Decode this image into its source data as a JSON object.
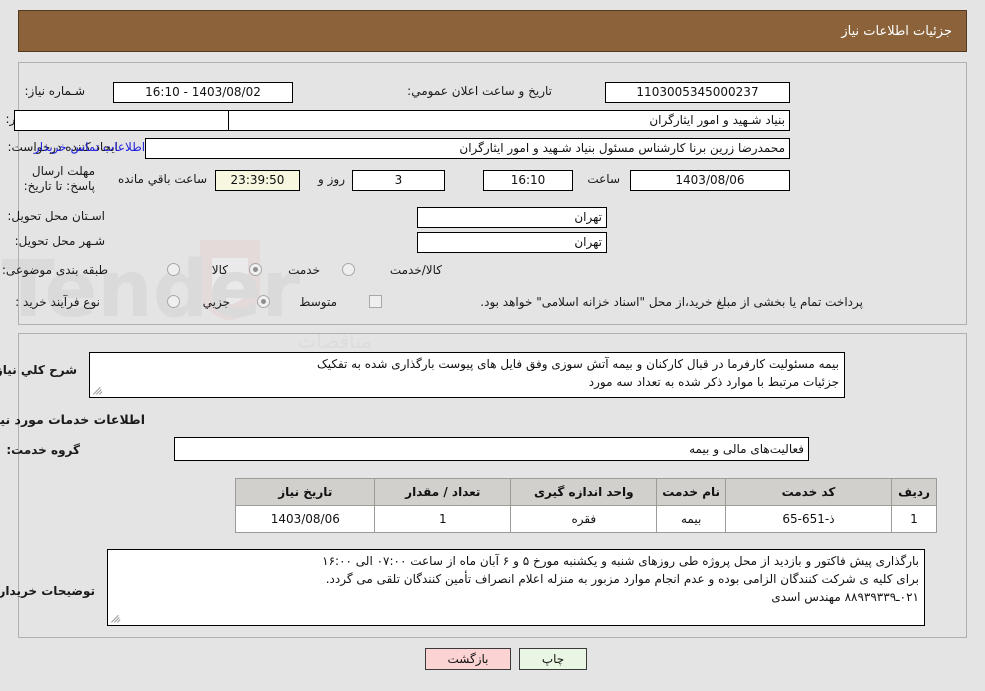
{
  "header": {
    "title": "جزئیات اطلاعات نیاز"
  },
  "top_section": {
    "need_number": {
      "label": "شـماره نیاز:",
      "value": "1103005345000237"
    },
    "public_announce": {
      "label": "تاریخ و ساعت اعلان عمومي:",
      "value": "1403/08/02 - 16:10"
    },
    "buyer_org": {
      "label": "نام دستگاه خریدار:",
      "value": "بنیاد شـهید و امور ایثارگران"
    },
    "buyer_org_extra": {
      "value": ""
    },
    "requester": {
      "label": "ایجاد کننده درخواست:",
      "value": "محمدرضا زرین برنا کارشناس مسئول  بنیاد شـهید و امور ایثارگران"
    },
    "contact_link": {
      "label": "اطلاعات تماس خریدار"
    },
    "deadline": {
      "label": "مهلت ارسال پاسخ: تا تاریخ:",
      "date": "1403/08/06",
      "time_label": "ساعت",
      "time": "16:10",
      "days": "3",
      "days_label": "روز و",
      "countdown": "23:39:50",
      "countdown_label": "ساعت باقي مانده"
    },
    "province": {
      "label": "اسـتان محل تحویل:",
      "value": "تهران"
    },
    "city": {
      "label": "شـهر محل تحویل:",
      "value": "تهران"
    },
    "category": {
      "label": "طبقه بندی موضوعی:",
      "options": [
        {
          "label": "کالا",
          "selected": false
        },
        {
          "label": "خدمت",
          "selected": true
        },
        {
          "label": "کالا/خدمت",
          "selected": false
        }
      ]
    },
    "purchase_process": {
      "label": "نوع فرآیند خرید :",
      "options": [
        {
          "label": "جزیي",
          "selected": false
        },
        {
          "label": "متوسط",
          "selected": true
        }
      ],
      "treasury_checkbox_label": "پرداخت تمام یا بخشی از مبلغ خرید،از محل \"اسناد خزانه اسلامی\" خواهد بود.",
      "treasury_checked": false
    }
  },
  "bottom_section": {
    "need_description": {
      "label": "شرح كلي نیاز:",
      "value": "بیمه مسئولیت کارفرما در قبال کارکنان و بیمه آتش سوزی وفق فایل های پیوست بارگذاری شده به تفکیک\nجزئیات مرتبط با موارد ذکر شده به تعداد سه مورد"
    },
    "services_heading": "اطلاعات خدمات مورد نیاز",
    "service_group": {
      "label": "گروه خدمت:",
      "value": "فعالیت‌های مالی و بیمه"
    },
    "table": {
      "columns": [
        "ردیف",
        "کد خدمت",
        "نام خدمت",
        "واحد اندازه گیری",
        "تعداد / مقدار",
        "تاریخ نیاز"
      ],
      "rows": [
        [
          "1",
          "ذ-651-65",
          "بیمه",
          "فقره",
          "1",
          "1403/08/06"
        ]
      ]
    },
    "buyer_notes": {
      "label": "توضیحات خریدار:",
      "value": "بارگذاری پیش فاکتور و بازدید از محل پروژه طی روزهای شنبه و یکشنبه مورخ ۵ و ۶ آبان ماه از ساعت ۰۷:۰۰ الی ۱۶:۰۰\nبرای کلیه ی شرکت کنندگان الزامی بوده و عدم انجام موارد مزبور به منزله اعلام انصراف تأمین کنندگان تلقی می گردد.\n۰۲۱ـ۸۸۹۳۹۳۳۹ مهندس اسدی"
    }
  },
  "footer": {
    "back_button": "بازگشت",
    "print_button": "چاپ"
  },
  "watermark": {
    "text": "anaTender"
  },
  "colors": {
    "header_bg": "#8b6239",
    "page_bg": "#e4e4e4",
    "link": "#2222dd",
    "timer_bg": "#f7f7e0",
    "back_button_bg": "#fbd3d3",
    "print_button_bg": "#e8f6e3",
    "table_header_bg": "#d2d0cd"
  }
}
